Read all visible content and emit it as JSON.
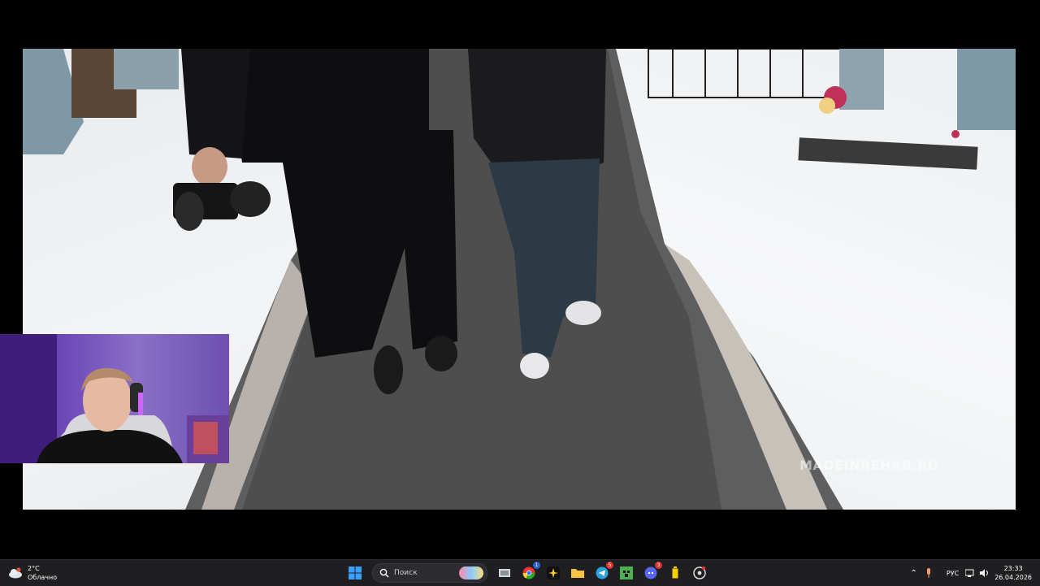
{
  "video": {
    "watermark": "MADEINREHAB.RU"
  },
  "taskbar": {
    "weather": {
      "temperature": "2°C",
      "condition": "Облачно",
      "icon": "cloudy-weather-icon"
    },
    "search_placeholder": "Поиск",
    "apps": [
      {
        "name": "file-explorer-icon"
      },
      {
        "name": "chrome-icon",
        "badge": "1"
      },
      {
        "name": "sparkle-app-icon"
      },
      {
        "name": "folder-icon"
      },
      {
        "name": "telegram-icon",
        "badge": "5"
      },
      {
        "name": "minecraft-icon"
      },
      {
        "name": "discord-icon",
        "badge": "3"
      },
      {
        "name": "battery-app-icon"
      },
      {
        "name": "obs-icon"
      }
    ],
    "tray": {
      "language": "РУС",
      "time": "23:33",
      "date": "26.04.2026"
    }
  },
  "colors": {
    "taskbar_bg": "#1f1f22",
    "accent": "#0a84ff"
  }
}
